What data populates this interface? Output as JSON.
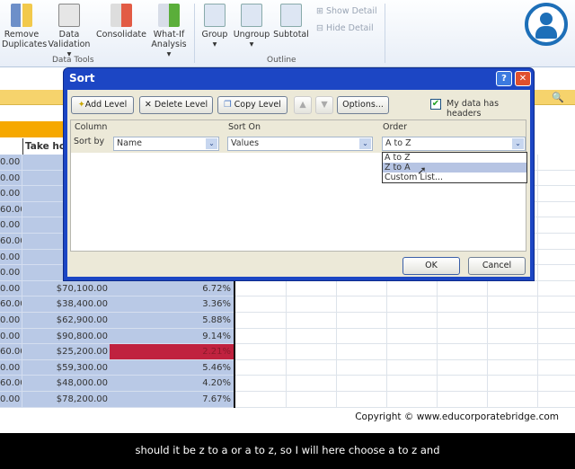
{
  "ribbon": {
    "buttons": [
      {
        "l1": "Remove",
        "l2": "Duplicates"
      },
      {
        "l1": "Data",
        "l2": "Validation ▾"
      },
      {
        "l1": "Consolidate",
        "l2": ""
      },
      {
        "l1": "What-If",
        "l2": "Analysis ▾"
      },
      {
        "l1": "Group",
        "l2": "▾"
      },
      {
        "l1": "Ungroup",
        "l2": "▾"
      },
      {
        "l1": "Subtotal",
        "l2": ""
      }
    ],
    "show_detail": "Show Detail",
    "hide_detail": "Hide Detail",
    "group_data_tools": "Data Tools",
    "group_outline": "Outline"
  },
  "sheet": {
    "header_col_b": "Take ho",
    "col_a": [
      "0.00",
      "0.00",
      "0.00",
      "60.00",
      "0.00",
      "60.00",
      "0.00",
      "0.00",
      "0.00",
      "60.00",
      "0.00",
      "0.00",
      "60.00",
      "0.00",
      "60.00",
      "0.00"
    ],
    "rows": [
      {
        "b": "$70,100.00",
        "c": "6.72%"
      },
      {
        "b": "$38,400.00",
        "c": "3.36%"
      },
      {
        "b": "$62,900.00",
        "c": "5.88%"
      },
      {
        "b": "$90,800.00",
        "c": "9.14%"
      },
      {
        "b": "$25,200.00",
        "c": "2.21%",
        "highlight": "#c0223f"
      },
      {
        "b": "$59,300.00",
        "c": "5.46%"
      },
      {
        "b": "$48,000.00",
        "c": "4.20%"
      },
      {
        "b": "$78,200.00",
        "c": "7.67%"
      }
    ]
  },
  "dialog": {
    "title": "Sort",
    "help": "?",
    "close": "✕",
    "add_level": "Add Level",
    "delete_level": "Delete Level",
    "copy_level": "Copy Level",
    "options": "Options...",
    "headers_label": "My data has headers",
    "headers_checked": true,
    "col_column": "Column",
    "col_sort_on": "Sort On",
    "col_order": "Order",
    "sort_by": "Sort by",
    "column_value": "Name",
    "sort_on_value": "Values",
    "order_value": "A to Z",
    "order_options": [
      "A to Z",
      "Z to A",
      "Custom List..."
    ],
    "ok": "OK",
    "cancel": "Cancel"
  },
  "copyright": "Copyright © www.educorporatebridge.com",
  "subtitle": "should it  be z to a or a to z, so  I will here  choose a to z and"
}
